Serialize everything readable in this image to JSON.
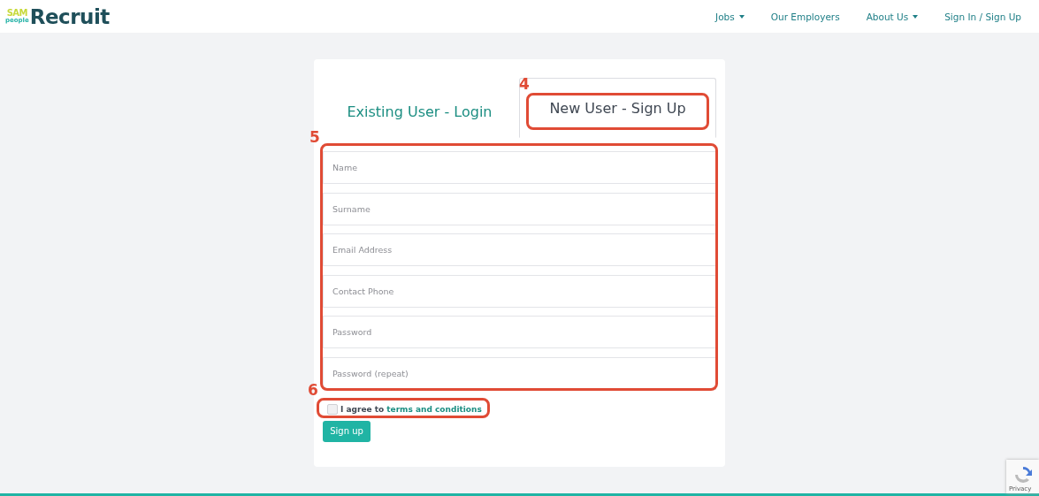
{
  "header": {
    "logo": {
      "top": "SAM",
      "bottom": "people",
      "word": "Recruit"
    },
    "nav": [
      {
        "label": "Jobs",
        "dropdown": true
      },
      {
        "label": "Our Employers",
        "dropdown": false
      },
      {
        "label": "About Us",
        "dropdown": true
      },
      {
        "label": "Sign In / Sign Up",
        "dropdown": false
      }
    ]
  },
  "tabs": [
    {
      "label": "Existing User - Login",
      "selected": false
    },
    {
      "label": "New User - Sign Up",
      "selected": true
    }
  ],
  "fields": [
    {
      "placeholder": "Name"
    },
    {
      "placeholder": "Surname"
    },
    {
      "placeholder": "Email Address"
    },
    {
      "placeholder": "Contact Phone"
    },
    {
      "placeholder": "Password"
    },
    {
      "placeholder": "Password (repeat)"
    }
  ],
  "agree": {
    "checked": false,
    "text": "I agree to",
    "link": "terms and conditions"
  },
  "submit": "Sign up",
  "recaptcha": {
    "text": "Privacy"
  },
  "annotations": [
    "4",
    "5",
    "6"
  ]
}
